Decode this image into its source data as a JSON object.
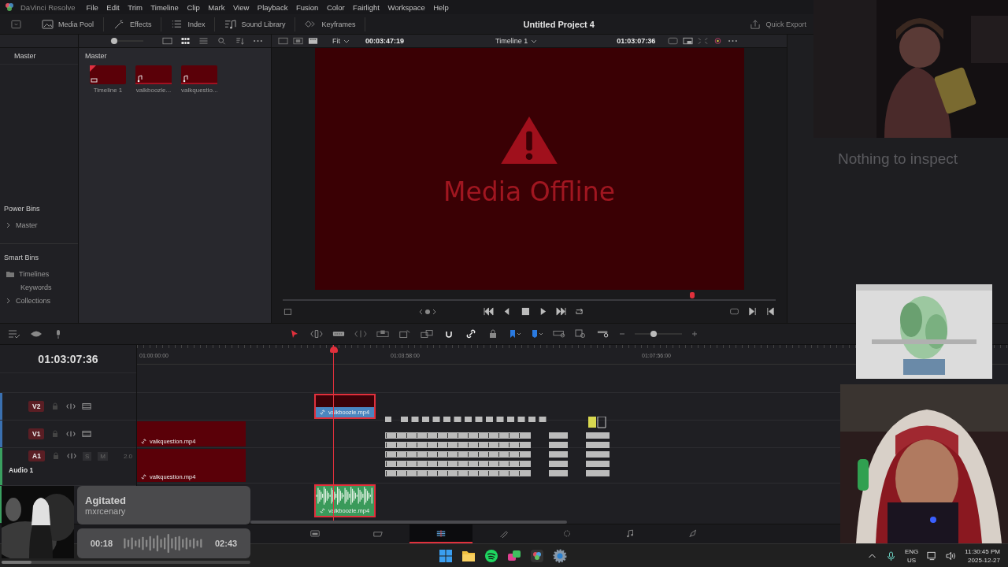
{
  "menu_bar": {
    "app_name": "DaVinci Resolve",
    "items": [
      "File",
      "Edit",
      "Trim",
      "Timeline",
      "Clip",
      "Mark",
      "View",
      "Playback",
      "Fusion",
      "Color",
      "Fairlight",
      "Workspace",
      "Help"
    ]
  },
  "toolbar": {
    "items": [
      {
        "label": "Media Pool",
        "kind": "media"
      },
      {
        "label": "Effects",
        "kind": "effects"
      },
      {
        "label": "Index",
        "kind": "index"
      },
      {
        "label": "Sound Library",
        "kind": "sound"
      },
      {
        "label": "Keyframes",
        "kind": "keyframes"
      }
    ],
    "project_title": "Untitled Project 4",
    "quick_export": "Quick Export"
  },
  "bins": {
    "header": "Master",
    "power_bins": {
      "title": "Power Bins",
      "items": [
        {
          "label": "Master",
          "expanded": false
        }
      ]
    },
    "smart_bins": {
      "title": "Smart Bins",
      "items": [
        {
          "label": "Timelines",
          "kind": "folder"
        },
        {
          "label": "Keywords",
          "kind": "plain"
        },
        {
          "label": "Collections",
          "kind": "collapsed"
        }
      ]
    }
  },
  "media_pool": {
    "thumb_size": {
      "level": 0.12
    },
    "path": "Master",
    "clips": [
      {
        "name": "Timeline 1",
        "kind": "timeline"
      },
      {
        "name": "valkboozle...",
        "kind": "audio"
      },
      {
        "name": "valkquestio...",
        "kind": "audio"
      }
    ]
  },
  "viewer": {
    "fit": "Fit",
    "source_timecode": "00:03:47:19",
    "timeline_name": "Timeline 1",
    "timecode": "01:03:07:36",
    "offline_message": "Media Offline",
    "scrubber": {
      "level": 0.83
    }
  },
  "inspector": {
    "empty_message": "Nothing to inspect"
  },
  "timeline": {
    "timecode": "01:03:07:36",
    "ruler": [
      "01:00:00:00",
      "01:03:58:00",
      "01:07:56:00"
    ],
    "zoom": {
      "level": 0.4
    },
    "tracks": [
      {
        "label": "V2",
        "kind": "video",
        "clips": [
          {
            "name": "valkboozle.mp4",
            "kind": "video",
            "selected": true
          }
        ]
      },
      {
        "label": "V1",
        "kind": "video",
        "clips": [
          {
            "name": "valkquestion.mp4",
            "kind": "offline",
            "selected": false
          }
        ]
      },
      {
        "label": "A1",
        "kind": "audio",
        "solo": "S",
        "mute": "M",
        "channels": "2.0",
        "name": "Audio 1",
        "clips": [
          {
            "name": "valkquestion.mp4",
            "kind": "offline",
            "selected": false
          }
        ]
      },
      {
        "kind": "audio",
        "clips": [
          {
            "name": "valkboozle.mp4",
            "kind": "audio",
            "selected": true
          }
        ]
      }
    ]
  },
  "page_tabs": [
    {
      "kind": "media",
      "selected": false
    },
    {
      "kind": "cut",
      "selected": false
    },
    {
      "kind": "edit",
      "selected": true
    },
    {
      "kind": "fusion",
      "selected": false
    },
    {
      "kind": "color",
      "selected": false
    },
    {
      "kind": "fairlight",
      "selected": false
    },
    {
      "kind": "deliver",
      "selected": false
    }
  ],
  "now_playing": {
    "title": "Agitated",
    "artist": "mxrcenary",
    "elapsed": "00:18",
    "duration": "02:43",
    "progress": {
      "level": 0.12
    }
  },
  "taskbar": {
    "language": "ENG",
    "region": "US",
    "time": "11:30:45 PM",
    "date": "2025-12-27"
  }
}
